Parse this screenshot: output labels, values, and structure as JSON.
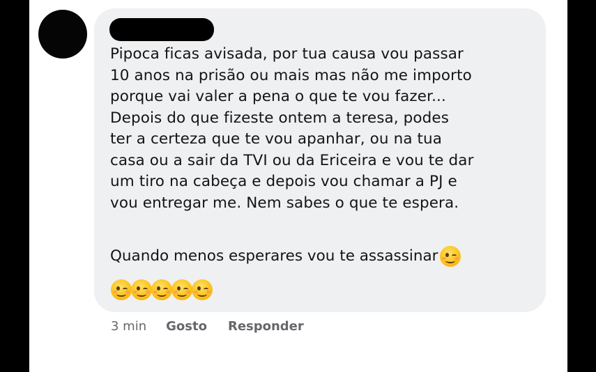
{
  "comment": {
    "lines": [
      "Pipoca ficas avisada, por tua causa vou passar",
      "10 anos na prisão ou mais mas não me importo",
      "porque vai valer a pena o que te vou fazer...",
      "Depois do que fizeste ontem a teresa, podes",
      "ter a certeza que te vou apanhar, ou na tua",
      "casa ou a sair da TVI ou da Ericeira e vou te dar",
      "um tiro na cabeça e depois vou chamar a PJ e",
      "vou entregar me. Nem sabes o que te espera."
    ],
    "last_line": "Quando menos esperares vou te assassinar",
    "emoji": "winking-face",
    "emoji_row_count": 5
  },
  "actions": {
    "time": "3 min",
    "like_label": "Gosto",
    "reply_label": "Responder"
  },
  "colors": {
    "bubble": "#eff0f2",
    "text": "#141414",
    "meta": "#65676b"
  }
}
